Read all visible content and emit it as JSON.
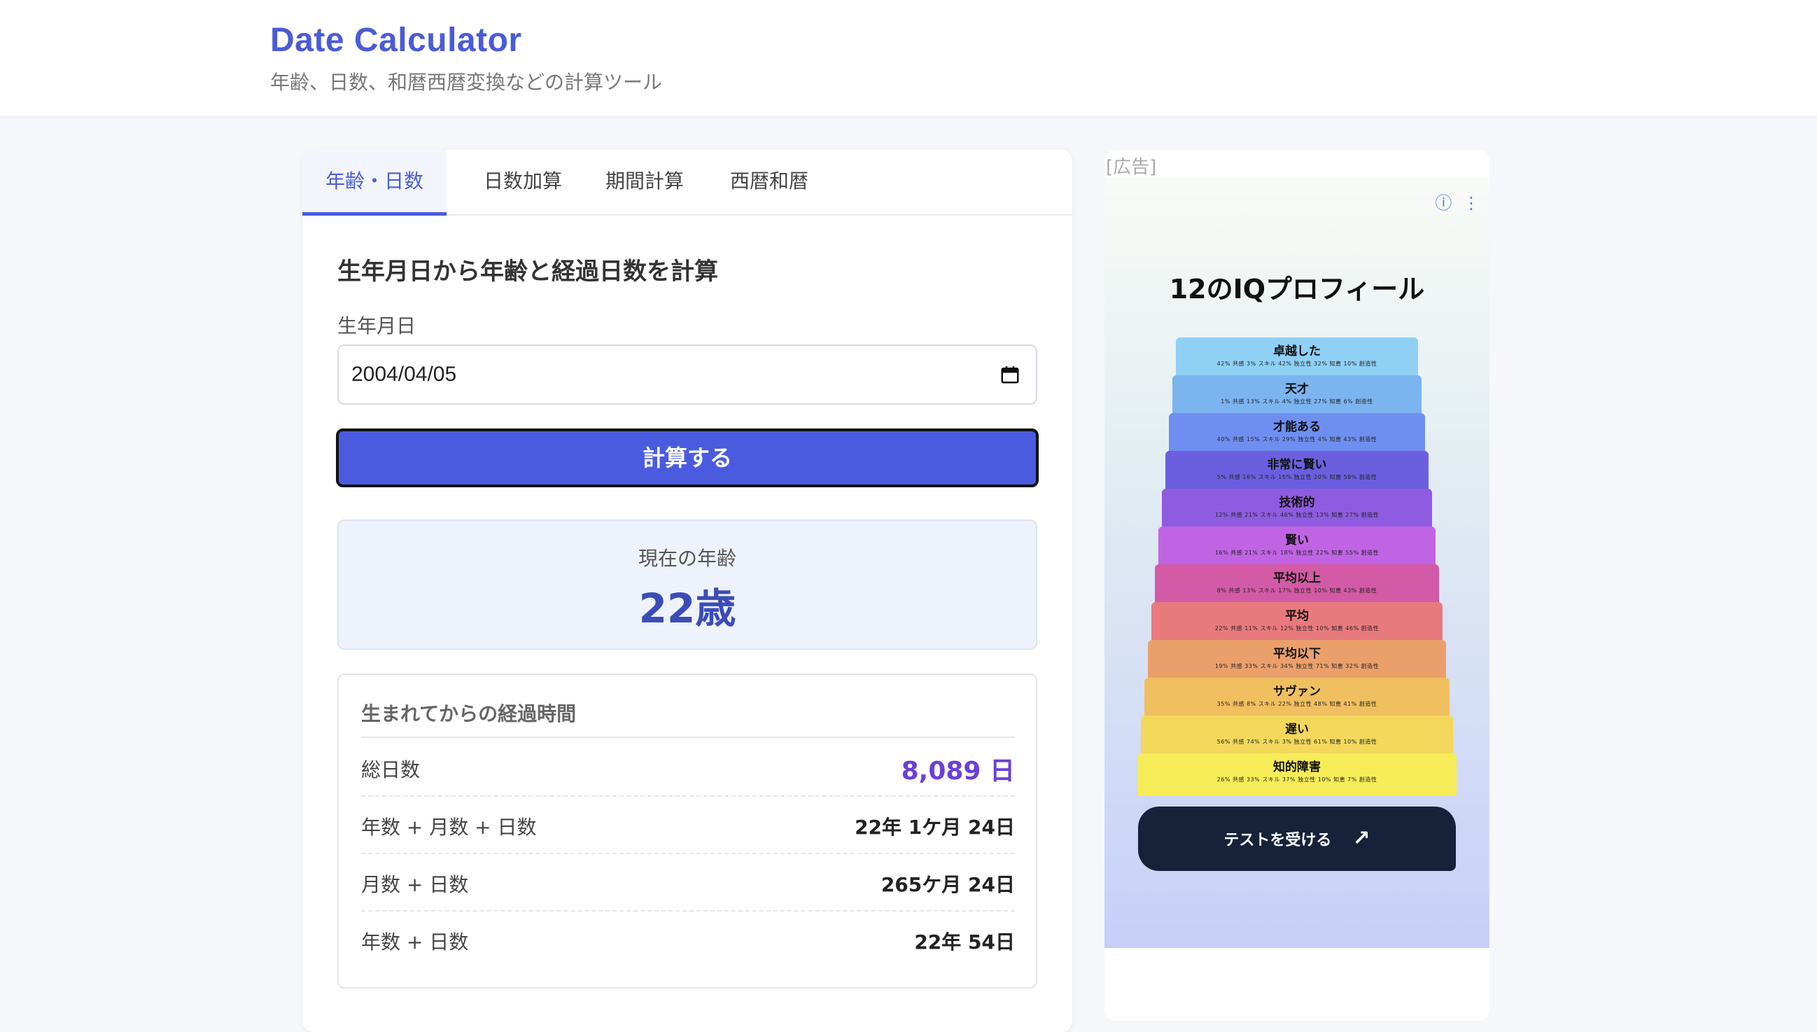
{
  "header": {
    "title": "Date Calculator",
    "subtitle": "年齢、日数、和暦西暦変換などの計算ツール"
  },
  "tabs": [
    {
      "label": "年齢・日数",
      "active": true
    },
    {
      "label": "日数加算",
      "active": false
    },
    {
      "label": "期間計算",
      "active": false
    },
    {
      "label": "西暦和暦",
      "active": false
    }
  ],
  "form": {
    "section_title": "生年月日から年齢と経過日数を計算",
    "birth_label": "生年月日",
    "birth_value": "2004/04/05",
    "calc_button": "計算する"
  },
  "result": {
    "age_label": "現在の年齢",
    "age_value": "22歳",
    "elapsed_title": "生まれてからの経過時間",
    "rows": [
      {
        "label": "総日数",
        "value": "8,089 日"
      },
      {
        "label": "年数 + 月数 + 日数",
        "value": "22年 1ケ月 24日"
      },
      {
        "label": "月数 + 日数",
        "value": "265ケ月 24日"
      },
      {
        "label": "年数 + 日数",
        "value": "22年 54日"
      }
    ]
  },
  "ad": {
    "tag": "[広告]",
    "headline": "12のIQプロフィール",
    "cta": "テストを受ける",
    "cta_icon": "arrow-up-right-icon",
    "tiers": [
      {
        "label": "卓越した",
        "color": "#8fd0f4",
        "stats": "42% 共感 3% スキル 42% 独立性 32% 知恵 10% 創造性"
      },
      {
        "label": "天才",
        "color": "#7cb4f0",
        "stats": "1% 共感 13% スキル 4% 独立性 27% 知恵 6% 創造性"
      },
      {
        "label": "才能ある",
        "color": "#6f8ff0",
        "stats": "40% 共感 15% スキル 29% 独立性 4% 知恵 43% 創造性"
      },
      {
        "label": "非常に賢い",
        "color": "#6b5fe0",
        "stats": "5% 共感 16% スキル 15% 独立性 20% 知恵 58% 創造性"
      },
      {
        "label": "技術的",
        "color": "#8f5be0",
        "stats": "12% 共感 21% スキル 46% 独立性 13% 知恵 27% 創造性"
      },
      {
        "label": "賢い",
        "color": "#c064e4",
        "stats": "16% 共感 21% スキル 18% 独立性 22% 知恵 55% 創造性"
      },
      {
        "label": "平均以上",
        "color": "#d35aa4",
        "stats": "8% 共感 13% スキル 17% 独立性 10% 知恵 43% 創造性"
      },
      {
        "label": "平均",
        "color": "#e87a7e",
        "stats": "22% 共感 11% スキル 12% 独立性 10% 知恵 46% 創造性"
      },
      {
        "label": "平均以下",
        "color": "#eba06c",
        "stats": "19% 共感 33% スキル 34% 独立性 71% 知恵 32% 創造性"
      },
      {
        "label": "サヴァン",
        "color": "#f0c060",
        "stats": "35% 共感 8% スキル 22% 独立性 48% 知恵 41% 創造性"
      },
      {
        "label": "遅い",
        "color": "#f3d85c",
        "stats": "56% 共感 74% スキル 3% 独立性 61% 知恵 10% 創造性"
      },
      {
        "label": "知的障害",
        "color": "#f6ec58",
        "stats": "26% 共感 33% スキル 37% 独立性 10% 知恵 7% 創造性"
      }
    ]
  }
}
